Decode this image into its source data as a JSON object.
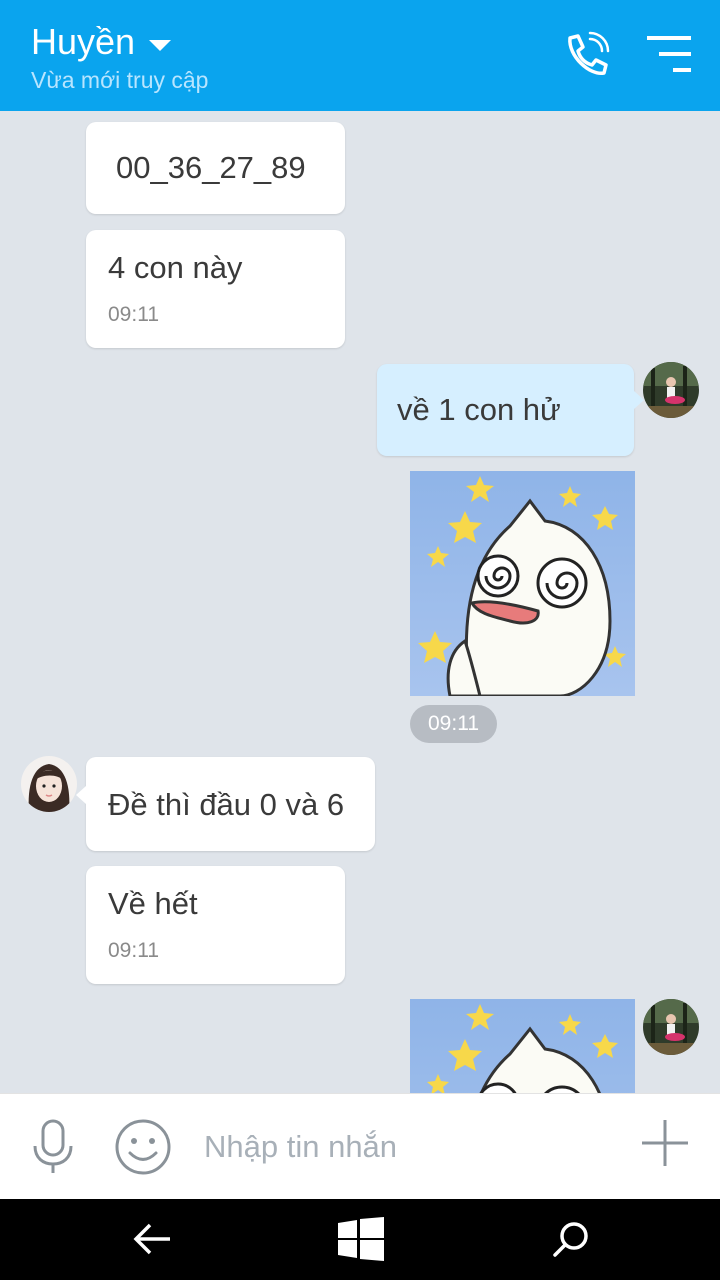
{
  "header": {
    "contact_name": "Huyền",
    "status": "Vừa mới truy cập"
  },
  "messages": {
    "m1_text": "00_36_27_89",
    "m2_text": "4 con này",
    "m2_time": "09:11",
    "m3_text": "về 1 con hử",
    "sticker1_time": "09:11",
    "m4_text": "Đề thì đầu 0 và 6",
    "m5_text": " Về hết",
    "m5_time": "09:11"
  },
  "input": {
    "placeholder": "Nhập tin nhắn"
  },
  "colors": {
    "header_bg": "#0aa4ee",
    "chat_bg": "#dfe4ea",
    "outgoing_bubble": "#d6efff",
    "incoming_bubble": "#ffffff"
  },
  "icons": {
    "call": "phone-call-icon",
    "filter": "filter-menu-icon",
    "mic": "microphone-icon",
    "emoji": "smiley-icon",
    "plus": "plus-icon",
    "back": "back-arrow-icon",
    "home": "windows-logo-icon",
    "search": "search-icon"
  }
}
